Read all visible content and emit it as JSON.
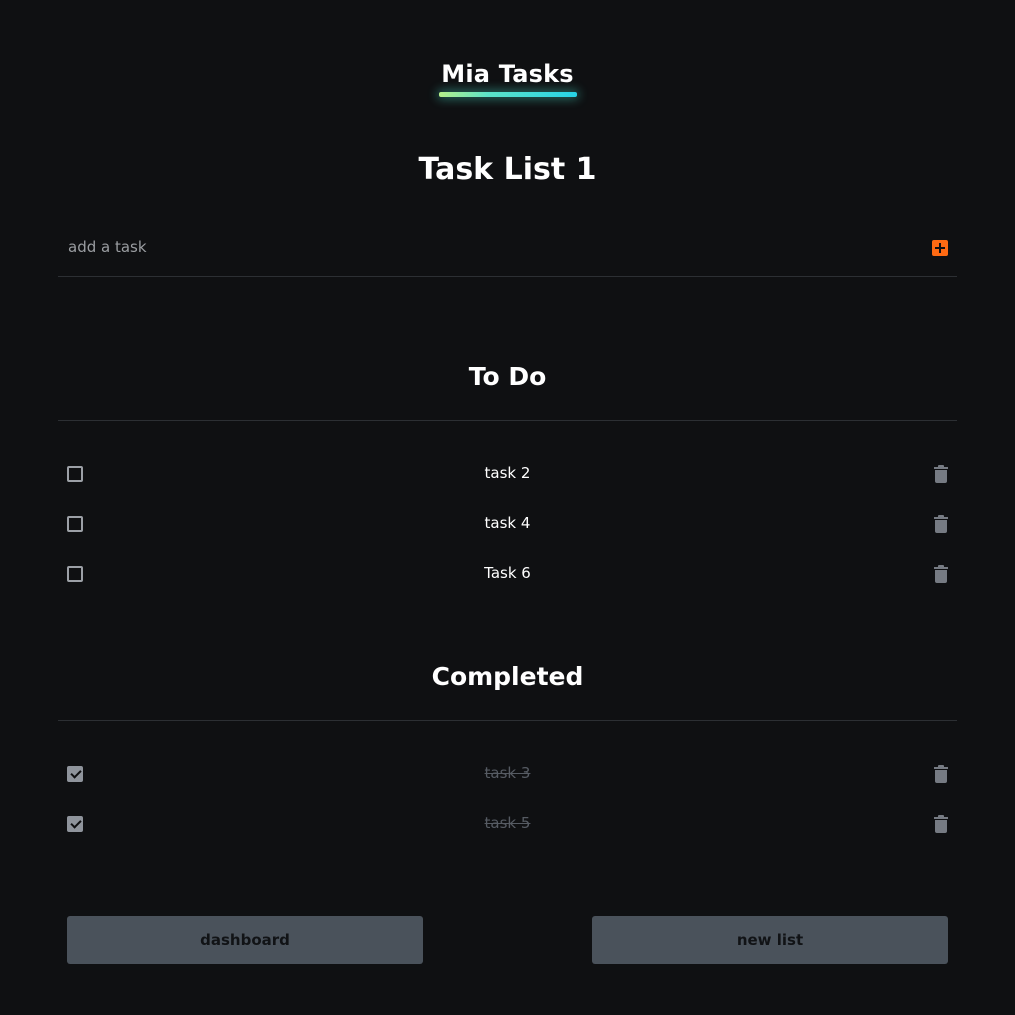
{
  "header": {
    "app_title": "Mia Tasks",
    "list_title": "Task List 1"
  },
  "add_task": {
    "placeholder": "add a task",
    "value": ""
  },
  "sections": {
    "todo": {
      "heading": "To Do",
      "tasks": [
        {
          "label": "task 2",
          "checked": false
        },
        {
          "label": "task 4",
          "checked": false
        },
        {
          "label": "Task 6",
          "checked": false
        }
      ]
    },
    "completed": {
      "heading": "Completed",
      "tasks": [
        {
          "label": "task 3",
          "checked": true
        },
        {
          "label": "task 5",
          "checked": true
        }
      ]
    }
  },
  "footer": {
    "dashboard_label": "dashboard",
    "new_list_label": "new list"
  },
  "icons": {
    "add": "plus-square-icon",
    "delete": "trash-icon",
    "checkbox": "checkbox-icon"
  },
  "colors": {
    "background": "#0f1012",
    "accent": "#ff6a13",
    "underline_start": "#b6f08a",
    "underline_end": "#27d3e6",
    "button_bg": "#4a525b",
    "muted_text": "#565b63"
  }
}
